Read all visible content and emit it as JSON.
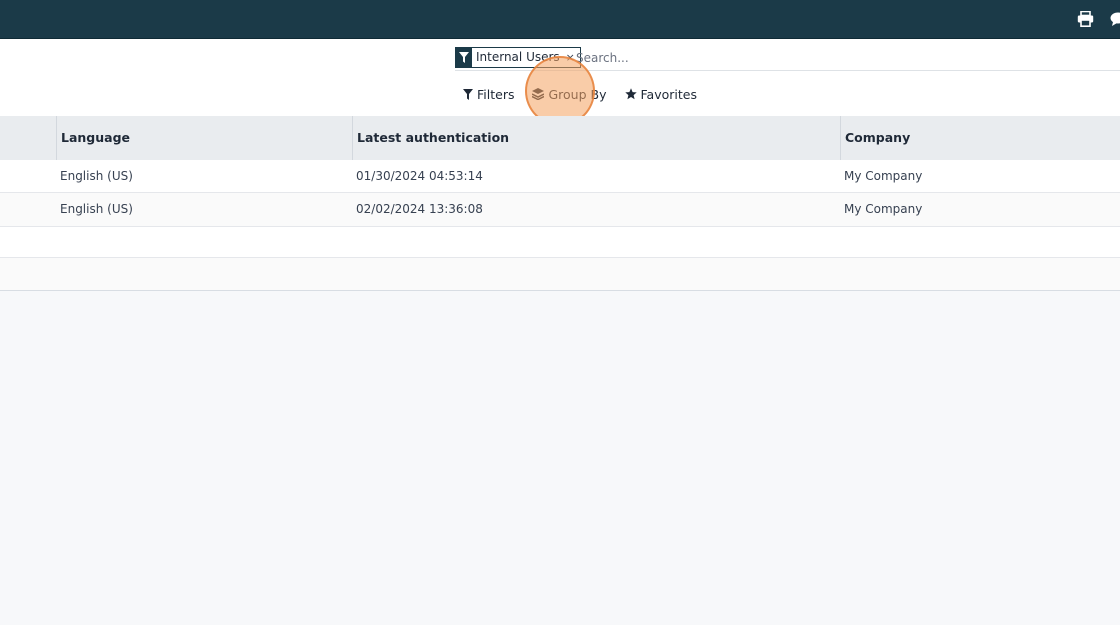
{
  "topbar": {
    "bg_color": "#1b3a48",
    "icons": [
      "print-icon",
      "chat-icon"
    ]
  },
  "search": {
    "facet": {
      "icon": "filter-icon",
      "value": "Internal Users",
      "remove": "×"
    },
    "placeholder": "Search..."
  },
  "toolbar": {
    "filters_label": "Filters",
    "group_by_label": "Group By",
    "favorites_label": "Favorites"
  },
  "table": {
    "columns": [
      "Language",
      "Latest authentication",
      "Company"
    ],
    "rows": [
      {
        "language": "English (US)",
        "latest_auth": "01/30/2024 04:53:14",
        "company": "My Company"
      },
      {
        "language": "English (US)",
        "latest_auth": "02/02/2024 13:36:08",
        "company": "My Company"
      }
    ]
  }
}
